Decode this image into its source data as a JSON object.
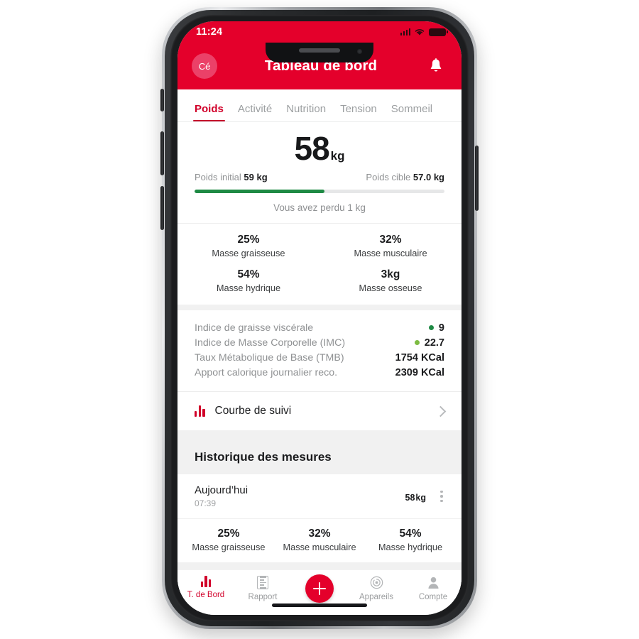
{
  "status_bar": {
    "time": "11:24",
    "signal_icon": "cellular-signal-icon",
    "wifi_icon": "wifi-icon",
    "battery_icon": "battery-icon"
  },
  "header": {
    "avatar_initials": "Cé",
    "title": "Tableau de bord",
    "bell_icon": "notification-bell-icon",
    "brand_color": "#E4002B"
  },
  "tabs": [
    {
      "label": "Poids",
      "active": true
    },
    {
      "label": "Activité",
      "active": false
    },
    {
      "label": "Nutrition",
      "active": false
    },
    {
      "label": "Tension",
      "active": false
    },
    {
      "label": "Sommeil",
      "active": false
    }
  ],
  "weight": {
    "value": "58",
    "unit": "kg",
    "initial_label": "Poids initial",
    "initial_value": "59 kg",
    "target_label": "Poids cible",
    "target_value": "57.0 kg",
    "progress_percent": 52,
    "progress_color": "#1E8A44",
    "lost_text": "Vous avez perdu 1 kg"
  },
  "composition": [
    {
      "value": "25%",
      "label": "Masse graisseuse"
    },
    {
      "value": "32%",
      "label": "Masse musculaire"
    },
    {
      "value": "54%",
      "label": "Masse hydrique"
    },
    {
      "value": "3kg",
      "label": "Masse osseuse"
    }
  ],
  "indices": [
    {
      "name": "Indice de graisse viscérale",
      "value": "9",
      "dot": true,
      "dot_color": "#1E8A44"
    },
    {
      "name": "Indice de Masse Corporelle (IMC)",
      "value": "22.7",
      "dot": true,
      "dot_color": "#7DBB42"
    },
    {
      "name": "Taux Métabolique de Base (TMB)",
      "value": "1754 KCal",
      "dot": false,
      "dot_color": ""
    },
    {
      "name": "Apport calorique journalier reco.",
      "value": "2309 KCal",
      "dot": false,
      "dot_color": ""
    }
  ],
  "curve_row": {
    "label": "Courbe de suivi",
    "icon": "bar-chart-icon",
    "chevron": "chevron-right-icon"
  },
  "history": {
    "title": "Historique des mesures",
    "entry": {
      "day": "Aujourd’hui",
      "time": "07:39",
      "weight": "58",
      "unit": "kg",
      "menu_icon": "kebab-menu-icon"
    },
    "composition": [
      {
        "value": "25%",
        "label": "Masse graisseuse"
      },
      {
        "value": "32%",
        "label": "Masse musculaire"
      },
      {
        "value": "54%",
        "label": "Masse hydrique"
      }
    ]
  },
  "bottom_nav": {
    "items": [
      {
        "label": "T. de Bord",
        "icon": "bar-chart-icon",
        "active": true
      },
      {
        "label": "Rapport",
        "icon": "report-list-icon",
        "active": false
      },
      {
        "label": "Appareils",
        "icon": "device-radar-icon",
        "active": false
      },
      {
        "label": "Compte",
        "icon": "user-account-icon",
        "active": false
      }
    ],
    "add_button": {
      "icon": "plus-icon",
      "label": ""
    }
  }
}
